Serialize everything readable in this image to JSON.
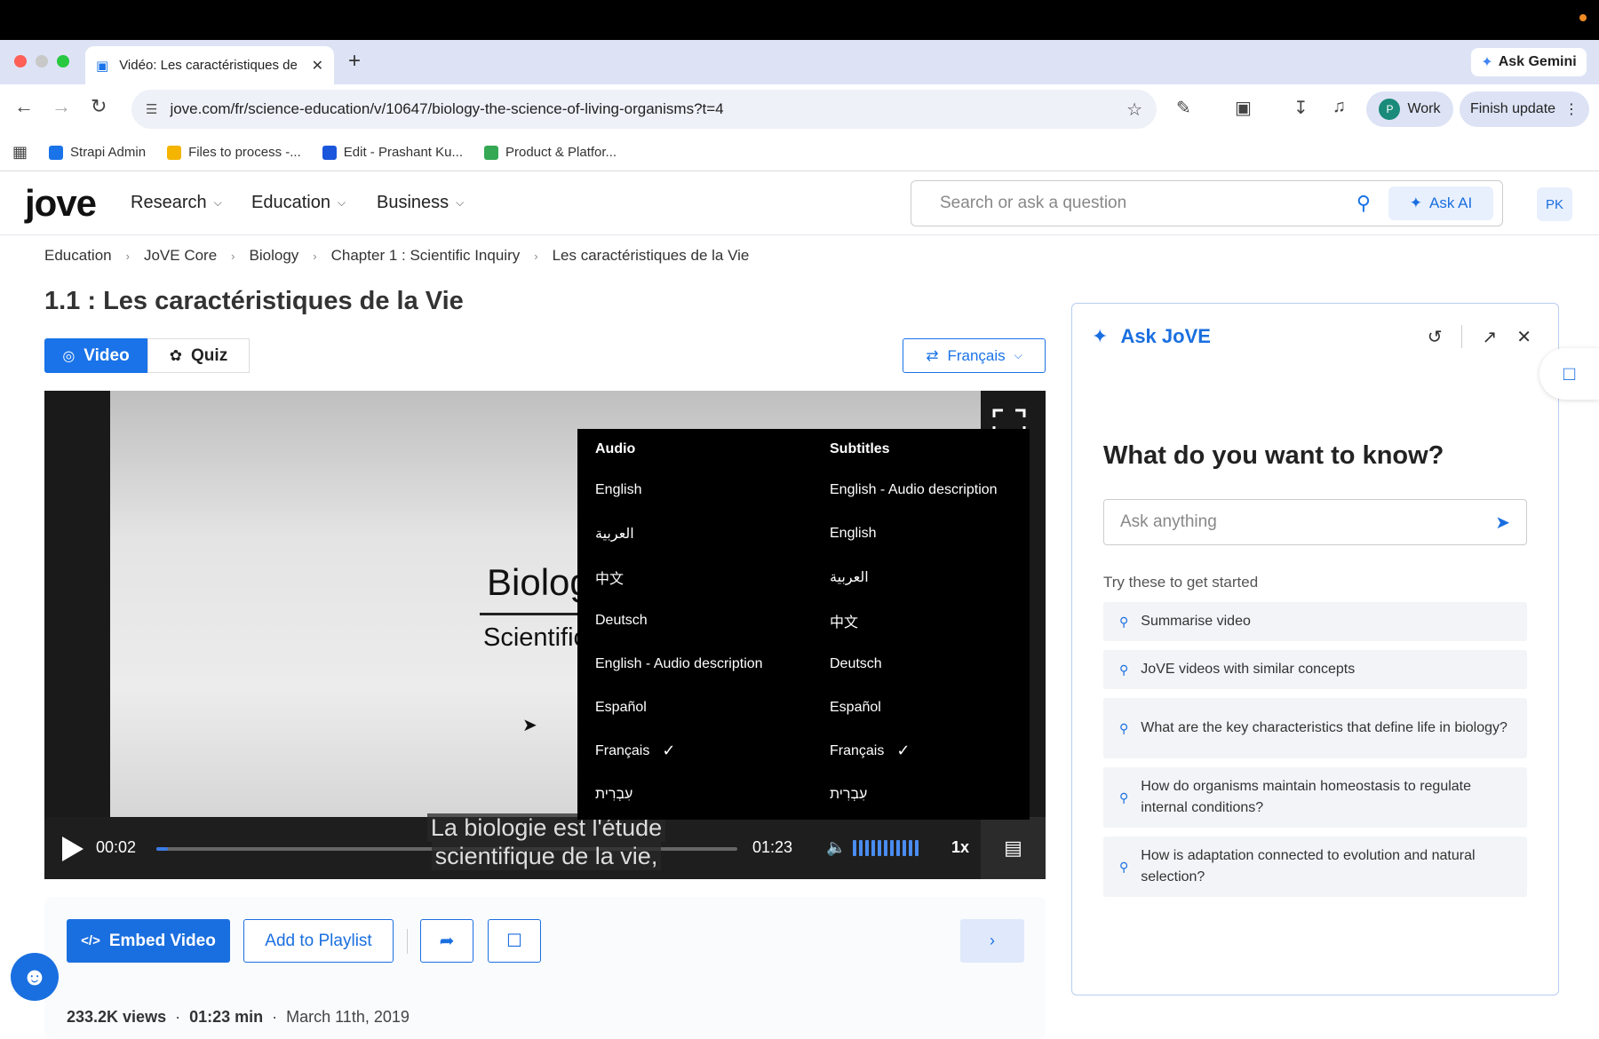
{
  "browser": {
    "tab_title": "Vidéo: Les caractéristiques de",
    "ask_gemini": "Ask Gemini",
    "url": "jove.com/fr/science-education/v/10647/biology-the-science-of-living-organisms?t=4",
    "profile_initial": "P",
    "profile_label": "Work",
    "finish_update": "Finish update",
    "bookmarks": [
      {
        "label": "Strapi Admin",
        "color": "#1a73e8"
      },
      {
        "label": "Files to process -...",
        "color": "#f4b400"
      },
      {
        "label": "Edit - Prashant Ku...",
        "color": "#1a56db"
      },
      {
        "label": "Product & Platfor...",
        "color": "#34a853"
      }
    ]
  },
  "site": {
    "logo": "jove",
    "nav": [
      {
        "label": "Research"
      },
      {
        "label": "Education"
      },
      {
        "label": "Business"
      }
    ],
    "search_placeholder": "Search or ask a question",
    "ask_ai": "Ask AI",
    "user_initials": "PK"
  },
  "breadcrumb": [
    "Education",
    "JoVE Core",
    "Biology",
    "Chapter 1 : Scientific Inquiry",
    "Les caractéristiques de la Vie"
  ],
  "page_title": "1.1 : Les caractéristiques de la Vie",
  "content_tabs": {
    "video": "Video",
    "quiz": "Quiz"
  },
  "language_selected": "Français",
  "video": {
    "frame_title": "Biolog",
    "frame_subtitle": "Scientific stud",
    "current_time": "00:02",
    "duration": "01:23",
    "progress_fraction": 0.02,
    "speed": "1x",
    "caption_line1": "La biologie est l'étude",
    "caption_line2": "scientifique de la vie,"
  },
  "av_menu": {
    "audio_header": "Audio",
    "subtitles_header": "Subtitles",
    "audio": [
      {
        "label": "English",
        "checked": false
      },
      {
        "label": "العربية",
        "checked": false
      },
      {
        "label": "中文",
        "checked": false
      },
      {
        "label": "Deutsch",
        "checked": false
      },
      {
        "label": "English - Audio description",
        "checked": false
      },
      {
        "label": "Español",
        "checked": false
      },
      {
        "label": "Français",
        "checked": true
      },
      {
        "label": "עִבְרִית",
        "checked": false
      }
    ],
    "subtitles": [
      {
        "label": "English - Audio description",
        "checked": false
      },
      {
        "label": "English",
        "checked": false
      },
      {
        "label": "العربية",
        "checked": false
      },
      {
        "label": "中文",
        "checked": false
      },
      {
        "label": "Deutsch",
        "checked": false
      },
      {
        "label": "Español",
        "checked": false
      },
      {
        "label": "Français",
        "checked": true
      },
      {
        "label": "עִבְרִית",
        "checked": false
      }
    ]
  },
  "actions": {
    "embed": "Embed Video",
    "playlist": "Add to Playlist",
    "views": "233.2K views",
    "length": "01:23 min",
    "date": "March 11th, 2019"
  },
  "ask_jove": {
    "title": "Ask JoVE",
    "question": "What do you want to know?",
    "input_placeholder": "Ask anything",
    "try_label": "Try these to get started",
    "suggestions": [
      "Summarise video",
      "JoVE videos with similar concepts",
      "What are the key characteristics that define life in biology?",
      "How do organisms maintain homeostasis to regulate internal conditions?",
      "How is adaptation connected to evolution and natural selection?"
    ]
  }
}
